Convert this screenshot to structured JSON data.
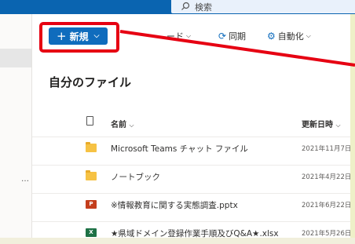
{
  "search": {
    "placeholder": "検索"
  },
  "command_bar": {
    "new_label": "新規",
    "download_label": "ード",
    "sync_label": "同期",
    "automate_label": "自動化"
  },
  "page_title": "自分のファイル",
  "columns": {
    "name": "名前",
    "modified": "更新日時"
  },
  "files": [
    {
      "name": "Microsoft Teams チャット ファイル",
      "modified": "2021年11月7日",
      "type": "folder"
    },
    {
      "name": "ノートブック",
      "modified": "2021年4月22日",
      "type": "folder"
    },
    {
      "name": "※情報教育に関する実態調査.pptx",
      "modified": "2021年6月22日",
      "type": "pptx"
    },
    {
      "name": "★県域ドメイン登録作業手順及びQ&A★.xlsx",
      "modified": "2021年5月26日",
      "type": "xlsx"
    }
  ],
  "leftnav": {
    "truncated_label": "…"
  },
  "annotation_color": "#e60012",
  "brand_color": "#0f6cbd"
}
